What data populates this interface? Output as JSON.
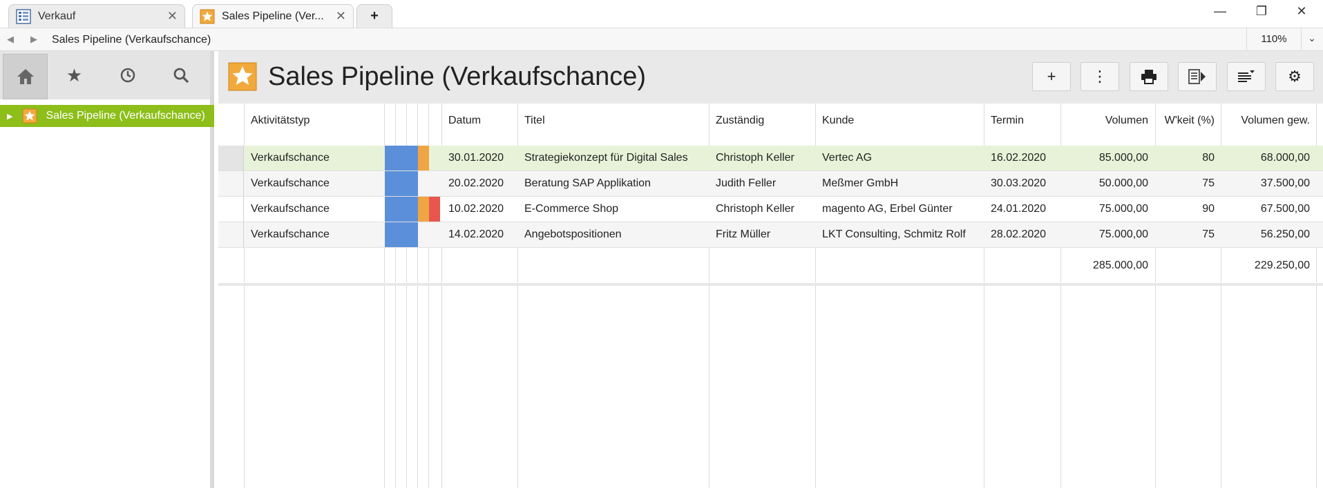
{
  "tabs": [
    {
      "label": "Verkauf",
      "icon": "list-icon"
    },
    {
      "label": "Sales Pipeline (Ver...",
      "icon": "star-folder-icon"
    }
  ],
  "new_tab_label": "+",
  "window": {
    "minimize": "—",
    "restore": "❐",
    "close": "✕"
  },
  "address": {
    "title": "Sales Pipeline (Verkaufschance)",
    "zoom": "110%"
  },
  "sidebar": {
    "tree": [
      {
        "label": "Sales Pipeline (Verkaufschance)"
      }
    ]
  },
  "header": {
    "title": "Sales Pipeline (Verkaufschance)"
  },
  "table": {
    "columns": {
      "aktivitaetstyp": "Aktivitätstyp",
      "datum": "Datum",
      "titel": "Titel",
      "zustaendig": "Zuständig",
      "kunde": "Kunde",
      "termin": "Termin",
      "volumen": "Volumen",
      "wkeit": "W'keit (%)",
      "volumen_gew": "Volumen gew."
    },
    "rows": [
      {
        "typ": "Verkaufschance",
        "datum": "30.01.2020",
        "titel": "Strategiekonzept für Digital Sales",
        "zustaendig": "Christoph Keller",
        "kunde": "Vertec AG",
        "termin": "16.02.2020",
        "volumen": "85.000,00",
        "wkeit": "80",
        "volumen_gew": "68.000,00"
      },
      {
        "typ": "Verkaufschance",
        "datum": "20.02.2020",
        "titel": "Beratung SAP Applikation",
        "zustaendig": "Judith Feller",
        "kunde": "Meßmer GmbH",
        "termin": "30.03.2020",
        "volumen": "50.000,00",
        "wkeit": "75",
        "volumen_gew": "37.500,00"
      },
      {
        "typ": "Verkaufschance",
        "datum": "10.02.2020",
        "titel": "E-Commerce Shop",
        "zustaendig": "Christoph Keller",
        "kunde": "magento AG, Erbel Günter",
        "termin": "24.01.2020",
        "volumen": "75.000,00",
        "wkeit": "90",
        "volumen_gew": "67.500,00"
      },
      {
        "typ": "Verkaufschance",
        "datum": "14.02.2020",
        "titel": "Angebotspositionen",
        "zustaendig": "Fritz Müller",
        "kunde": "LKT Consulting, Schmitz Rolf",
        "termin": "28.02.2020",
        "volumen": "75.000,00",
        "wkeit": "75",
        "volumen_gew": "56.250,00"
      }
    ],
    "totals": {
      "volumen": "285.000,00",
      "volumen_gew": "229.250,00"
    }
  },
  "colors": {
    "accent_green": "#8dbe1a",
    "selected_row": "#e8f2d8",
    "indicator_blue": "#5b8fd9",
    "indicator_orange": "#f0a545",
    "indicator_red": "#e8564d"
  }
}
